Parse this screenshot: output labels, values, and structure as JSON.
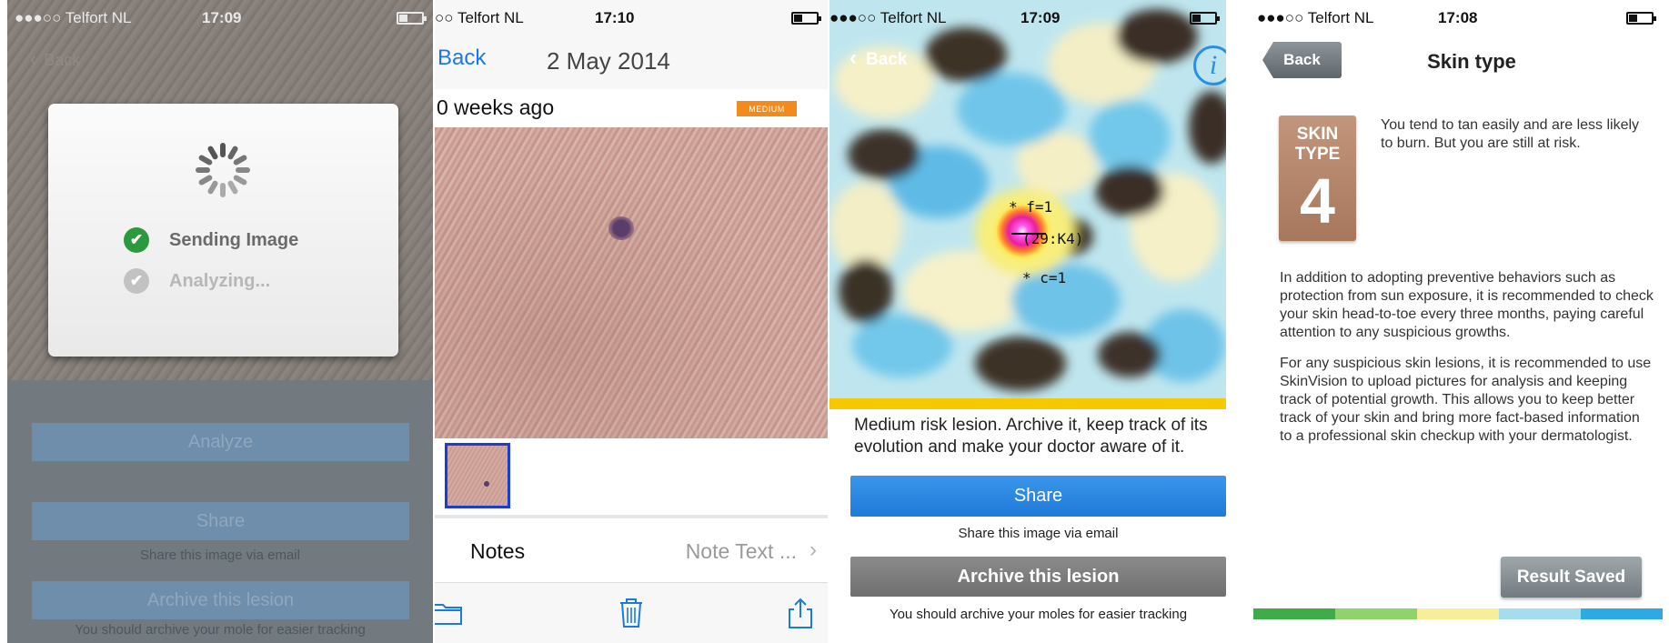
{
  "status_bar": [
    {
      "carrier": "●●●○○ Telfort NL",
      "time": "17:09"
    },
    {
      "carrier": "○○ Telfort NL",
      "time": "17:10"
    },
    {
      "carrier": "●●●○○ Telfort NL",
      "time": "17:09"
    },
    {
      "carrier": "●●●○○ Telfort NL",
      "time": "17:08"
    }
  ],
  "screen1": {
    "back_label": "Back",
    "steps": [
      "Sending Image",
      "Analyzing..."
    ],
    "analyze_label": "Analyze",
    "share_label": "Share",
    "share_sub": "Share this image via email",
    "archive_label": "Archive this lesion",
    "archive_sub": "You should archive your mole for easier tracking"
  },
  "screen2": {
    "back_label": "Back",
    "date": "2 May 2014",
    "age": "0 weeks ago",
    "risk_badge": "MEDIUM",
    "notes_label": "Notes",
    "notes_value": "Note Text ...",
    "toolbar_icons": [
      "folder-icon",
      "trash-icon",
      "share-icon"
    ]
  },
  "screen3": {
    "back_label": "Back",
    "info_label": "i",
    "annotations": [
      "* f=1",
      "(29:K4)",
      "* c=1"
    ],
    "message": "Medium risk lesion. Archive it, keep track of its evolution and make your doctor aware of it.",
    "share_label": "Share",
    "share_sub": "Share this image via email",
    "archive_label": "Archive this lesion",
    "archive_sub": "You should archive your moles for easier tracking"
  },
  "screen4": {
    "back_label": "Back",
    "title": "Skin type",
    "card_label_1": "SKIN",
    "card_label_2": "TYPE",
    "card_number": "4",
    "intro": "You tend to tan easily and are less likely to burn. But you are still at risk.",
    "paragraph_1": "In addition to adopting preventive behaviors such as protection from sun exposure, it is recommended to check your skin head-to-toe every three months, paying careful attention to any suspicious growths.",
    "paragraph_2": "For any suspicious skin lesions, it is recommended to use SkinVision to upload pictures for analysis and keeping track of potential growth. This allows you to keep better track of your skin and bring more fact-based information to a professional skin checkup with your dermatologist.",
    "result_label": "Result Saved",
    "scale_colors": [
      "#3fab4b",
      "#8fd36c",
      "#f7ee9a",
      "#a7dcef",
      "#2eaae2"
    ]
  },
  "colors": {
    "ios_blue": "#1b7ae0",
    "medium_badge": "#f28a1c",
    "medium_risk_bar": "#f6c800",
    "check_green": "#2b9a3c"
  }
}
